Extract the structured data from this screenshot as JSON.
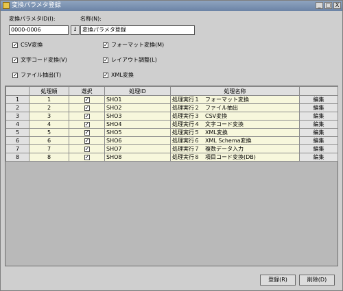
{
  "window": {
    "title": "変換パラメタ登録",
    "min_label": "_",
    "max_label": "□",
    "close_label": "X"
  },
  "form": {
    "param_id_label": "変換パラメタID(I):",
    "param_id_value": "0000-0006",
    "name_label": "名称(N):",
    "name_value": "変換パラメタ登録",
    "lookup_icon": "arrow-down-icon"
  },
  "options": [
    {
      "label": "CSV変換"
    },
    {
      "label": "フォーマット変換(M)"
    },
    {
      "label": "文字コード変換(V)"
    },
    {
      "label": "レイアウト調整(L)"
    },
    {
      "label": "ファイル抽出(T)"
    },
    {
      "label": "XML変換"
    }
  ],
  "table": {
    "headers": [
      "",
      "処理順",
      "選択",
      "処理ID",
      "処理名称",
      ""
    ],
    "rows": [
      {
        "row": "1",
        "order": "1",
        "id": "SHO1",
        "name": "処理実行１　フォーマット変換",
        "edit": "編集"
      },
      {
        "row": "2",
        "order": "2",
        "id": "SHO2",
        "name": "処理実行２　ファイル抽出",
        "edit": "編集"
      },
      {
        "row": "3",
        "order": "3",
        "id": "SHO3",
        "name": "処理実行３　CSV変換",
        "edit": "編集"
      },
      {
        "row": "4",
        "order": "4",
        "id": "SHO4",
        "name": "処理実行４　文字コード変換",
        "edit": "編集"
      },
      {
        "row": "5",
        "order": "5",
        "id": "SHO5",
        "name": "処理実行５　XML変換",
        "edit": "編集"
      },
      {
        "row": "6",
        "order": "6",
        "id": "SHO6",
        "name": "処理実行６　XML Schema変換",
        "edit": "編集"
      },
      {
        "row": "7",
        "order": "7",
        "id": "SHO7",
        "name": "処理実行７　複数データ入力",
        "edit": "編集"
      },
      {
        "row": "8",
        "order": "8",
        "id": "SHO8",
        "name": "処理実行８　項目コード変換(DB)",
        "edit": "編集"
      }
    ]
  },
  "buttons": {
    "register": "登録(R)",
    "delete": "削除(D)"
  }
}
